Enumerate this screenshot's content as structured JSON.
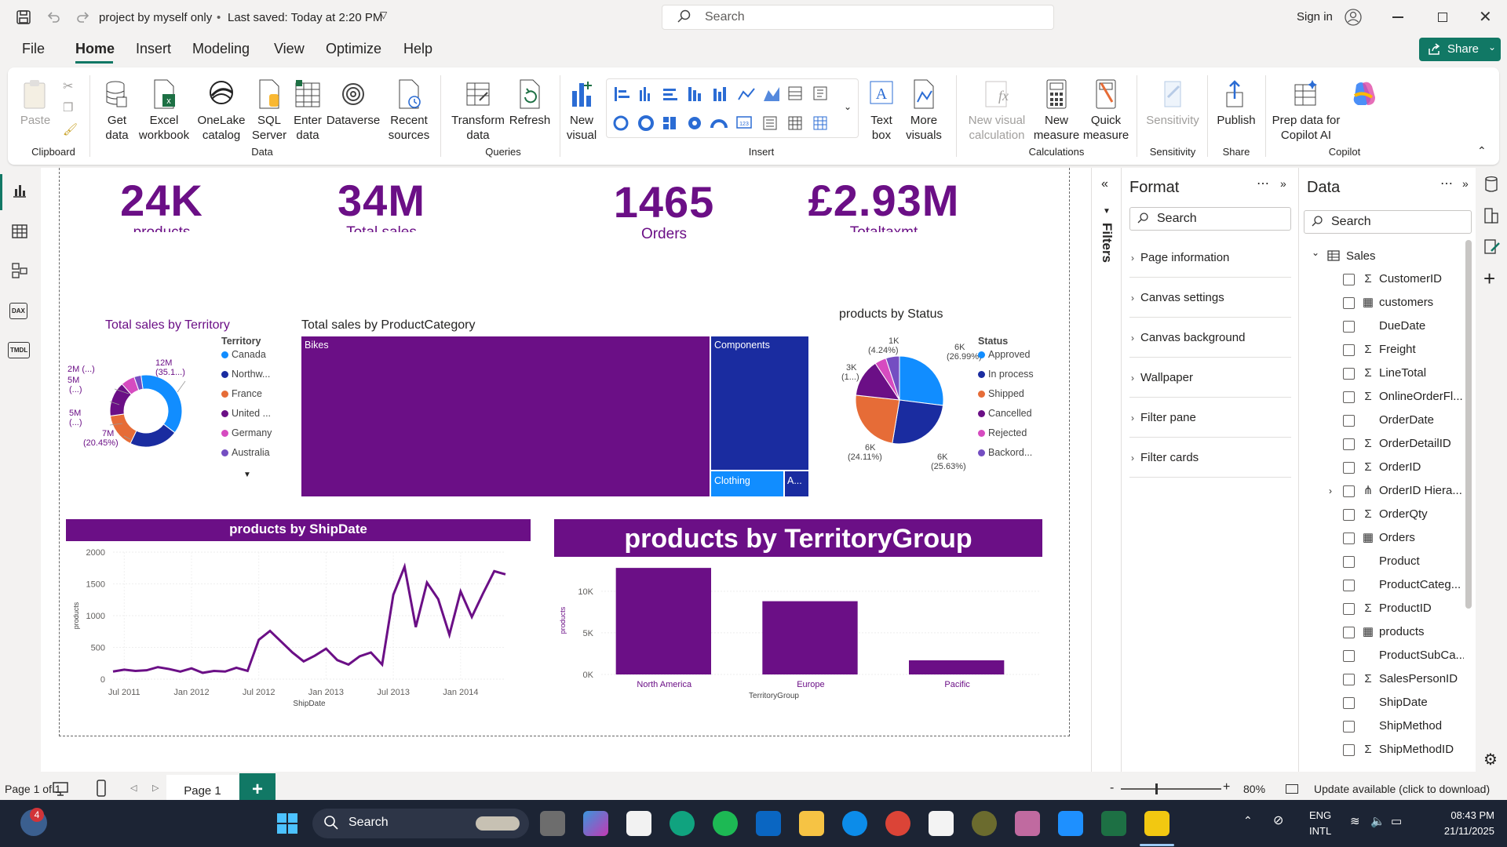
{
  "titlebar": {
    "doc_title": "project by myself only",
    "saved": "Last saved: Today at 2:20 PM",
    "search_placeholder": "Search",
    "sign_in": "Sign in"
  },
  "menu": [
    "File",
    "Home",
    "Insert",
    "Modeling",
    "View",
    "Optimize",
    "Help"
  ],
  "share_label": "Share",
  "ribbon": {
    "paste": "Paste",
    "clipboard": "Clipboard",
    "get_data": "Get data",
    "excel": "Excel workbook",
    "onelake": "OneLake catalog",
    "sql": "SQL Server",
    "enter": "Enter data",
    "dataverse": "Dataverse",
    "recent": "Recent sources",
    "data_group": "Data",
    "transform": "Transform data",
    "refresh": "Refresh",
    "queries_group": "Queries",
    "new_visual": "New visual",
    "insert_group": "Insert",
    "text_box": "Text box",
    "more_visuals": "More visuals",
    "new_visual_calc": "New visual calculation",
    "new_measure": "New measure",
    "quick_measure": "Quick measure",
    "calc_group": "Calculations",
    "sensitivity": "Sensitivity",
    "sensitivity_group": "Sensitivity",
    "publish": "Publish",
    "share_group": "Share",
    "copilot_btn": "Prep data for Copilot AI",
    "copilot_group": "Copilot"
  },
  "kpis": [
    {
      "value": "24K",
      "label": "products"
    },
    {
      "value": "34M",
      "label": "Total sales"
    },
    {
      "value": "1465",
      "label": "Orders"
    },
    {
      "value": "£2.93M",
      "label": "Totaltaxmt"
    }
  ],
  "colors": {
    "purple": "#6b0f86",
    "navy": "#1a2ca0",
    "blue": "#118dff",
    "orange": "#e66c37",
    "pink": "#d64bc0",
    "violet": "#744ec2",
    "ribbon_green": "#117865"
  },
  "territory_chart": {
    "title": "Total sales by Territory",
    "legend_title": "Territory",
    "legend": [
      "Canada",
      "Northw...",
      "France",
      "United ...",
      "Germany",
      "Australia"
    ],
    "labels": [
      "12M (35.1...)",
      "2M (...)",
      "5M (...)",
      "5M (...)",
      "7M (20.45%)"
    ]
  },
  "category_chart": {
    "title": "Total sales by ProductCategory",
    "tiles": [
      "Bikes",
      "Components",
      "Clothing",
      "A..."
    ]
  },
  "status_chart": {
    "title": "products by Status",
    "legend_title": "Status",
    "legend": [
      "Approved",
      "In process",
      "Shipped",
      "Cancelled",
      "Rejected",
      "Backord..."
    ],
    "labels": [
      "1K (4.24%)",
      "3K (1...)",
      "6K (26.99%)",
      "6K (24.11%)",
      "6K (25.63%)"
    ]
  },
  "shipdate_chart": {
    "title": "products by ShipDate",
    "xlabel": "ShipDate",
    "ylabel": "products",
    "yticks": [
      "2000",
      "1500",
      "1000",
      "500",
      "0"
    ],
    "xticks": [
      "Jul 2011",
      "Jan 2012",
      "Jul 2012",
      "Jan 2013",
      "Jul 2013",
      "Jan 2014"
    ]
  },
  "tgroup_chart": {
    "title": "products by TerritoryGroup",
    "xlabel": "TerritoryGroup",
    "ylabel": "products",
    "yticks": [
      "10K",
      "5K",
      "0K"
    ]
  },
  "chart_data": [
    {
      "type": "pie",
      "title": "Total sales by Territory",
      "donut": true,
      "categories": [
        "Canada",
        "Northwest",
        "France",
        "United Kingdom",
        "Germany",
        "Australia"
      ],
      "values": [
        12,
        7,
        5,
        5,
        2,
        1
      ],
      "percent": [
        35.1,
        20.45,
        null,
        null,
        null,
        null
      ],
      "colors": [
        "#118dff",
        "#1a2ca0",
        "#e66c37",
        "#6b0f86",
        "#d64bc0",
        "#744ec2"
      ]
    },
    {
      "type": "heatmap",
      "title": "Total sales by ProductCategory",
      "categories": [
        "Bikes",
        "Components",
        "Clothing",
        "Accessories"
      ],
      "values": [
        27.5,
        4.7,
        1.3,
        0.4
      ]
    },
    {
      "type": "pie",
      "title": "products by Status",
      "categories": [
        "Approved",
        "In process",
        "Shipped",
        "Cancelled",
        "Rejected",
        "Backordered"
      ],
      "values": [
        26.99,
        25.63,
        24.11,
        14.0,
        4.24,
        5.03
      ],
      "colors": [
        "#118dff",
        "#1a2ca0",
        "#e66c37",
        "#6b0f86",
        "#d64bc0",
        "#744ec2"
      ]
    },
    {
      "type": "line",
      "title": "products by ShipDate",
      "xlabel": "ShipDate",
      "ylabel": "products",
      "ylim": [
        0,
        2000
      ],
      "x": [
        "Jun 2011",
        "Jul 2011",
        "Aug 2011",
        "Sep 2011",
        "Oct 2011",
        "Nov 2011",
        "Dec 2011",
        "Jan 2012",
        "Feb 2012",
        "Mar 2012",
        "Apr 2012",
        "May 2012",
        "Jun 2012",
        "Jul 2012",
        "Aug 2012",
        "Sep 2012",
        "Oct 2012",
        "Nov 2012",
        "Dec 2012",
        "Jan 2013",
        "Feb 2013",
        "Mar 2013",
        "Apr 2013",
        "May 2013",
        "Jun 2013",
        "Jul 2013",
        "Aug 2013",
        "Sep 2013",
        "Oct 2013",
        "Nov 2013",
        "Dec 2013",
        "Jan 2014",
        "Feb 2014",
        "Mar 2014",
        "Apr 2014",
        "May 2014"
      ],
      "series": [
        {
          "values": [
            120,
            150,
            130,
            140,
            190,
            160,
            120,
            170,
            100,
            130,
            120,
            180,
            130,
            620,
            760,
            590,
            420,
            280,
            370,
            480,
            300,
            230,
            360,
            420,
            230,
            1330,
            1770,
            820,
            1520,
            1260,
            700,
            1380,
            980,
            1350,
            1700,
            1650
          ]
        }
      ]
    },
    {
      "type": "bar",
      "title": "products by TerritoryGroup",
      "categories": [
        "North America",
        "Europe",
        "Pacific"
      ],
      "values": [
        12800,
        8800,
        1700
      ],
      "xlabel": "TerritoryGroup",
      "ylabel": "products",
      "ylim": [
        0,
        13000
      ]
    }
  ],
  "filters_label": "Filters",
  "format_pane": {
    "title": "Format",
    "search": "Search",
    "items": [
      "Page information",
      "Canvas settings",
      "Canvas background",
      "Wallpaper",
      "Filter pane",
      "Filter cards"
    ]
  },
  "data_pane": {
    "title": "Data",
    "search": "Search",
    "table": "Sales",
    "fields": [
      {
        "name": "CustomerID",
        "icon": "sigma"
      },
      {
        "name": "customers",
        "icon": "calc"
      },
      {
        "name": "DueDate",
        "icon": ""
      },
      {
        "name": "Freight",
        "icon": "sigma"
      },
      {
        "name": "LineTotal",
        "icon": "sigma"
      },
      {
        "name": "OnlineOrderFl...",
        "icon": "sigma"
      },
      {
        "name": "OrderDate",
        "icon": ""
      },
      {
        "name": "OrderDetailID",
        "icon": "sigma"
      },
      {
        "name": "OrderID",
        "icon": "sigma"
      },
      {
        "name": "OrderID Hiera...",
        "icon": "hier"
      },
      {
        "name": "OrderQty",
        "icon": "sigma"
      },
      {
        "name": "Orders",
        "icon": "calc"
      },
      {
        "name": "Product",
        "icon": ""
      },
      {
        "name": "ProductCateg...",
        "icon": ""
      },
      {
        "name": "ProductID",
        "icon": "sigma"
      },
      {
        "name": "products",
        "icon": "calc"
      },
      {
        "name": "ProductSubCa...",
        "icon": ""
      },
      {
        "name": "SalesPersonID",
        "icon": "sigma"
      },
      {
        "name": "ShipDate",
        "icon": ""
      },
      {
        "name": "ShipMethod",
        "icon": ""
      },
      {
        "name": "ShipMethodID",
        "icon": "sigma"
      }
    ]
  },
  "pages": {
    "tab": "Page 1",
    "add": "+"
  },
  "status": {
    "page": "Page 1 of 1",
    "zoom": "80%",
    "update": "Update available (click to download)"
  },
  "taskbar": {
    "search": "Search",
    "badge": "4",
    "lang1": "ENG",
    "lang2": "INTL",
    "time": "08:43 PM",
    "date": "21/11/2025"
  }
}
